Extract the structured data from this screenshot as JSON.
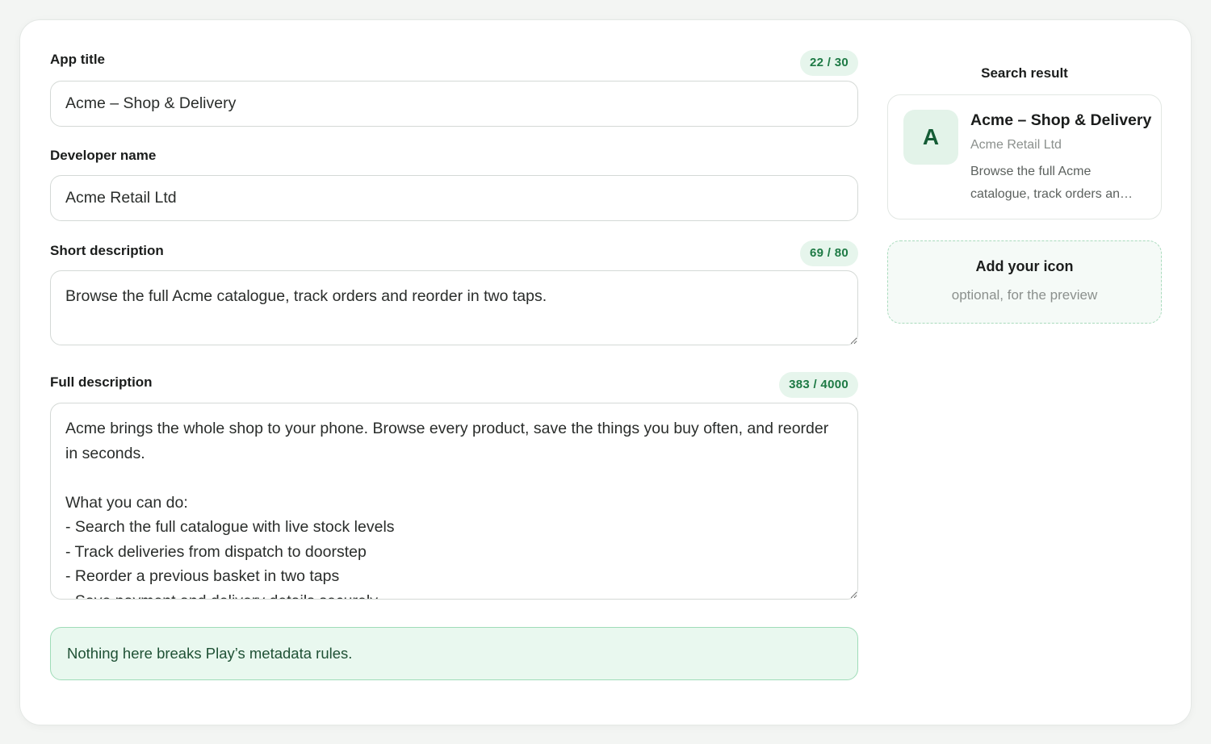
{
  "form": {
    "app_title": {
      "label": "App title",
      "counter": "22 / 30",
      "value": "Acme – Shop & Delivery"
    },
    "developer_name": {
      "label": "Developer name",
      "value": "Acme Retail Ltd"
    },
    "short_description": {
      "label": "Short description",
      "counter": "69 / 80",
      "value": "Browse the full Acme catalogue, track orders and reorder in two taps."
    },
    "full_description": {
      "label": "Full description",
      "counter": "383 / 4000",
      "value": "Acme brings the whole shop to your phone. Browse every product, save the things you buy often, and reorder in seconds.\n\nWhat you can do:\n- Search the full catalogue with live stock levels\n- Track deliveries from dispatch to doorstep\n- Reorder a previous basket in two taps\n- Save payment and delivery details securely"
    },
    "status_message": "Nothing here breaks Play’s metadata rules."
  },
  "preview": {
    "heading": "Search result",
    "icon_letter": "A",
    "title": "Acme – Shop & Delivery",
    "developer": "Acme Retail Ltd",
    "desc_line1": "Browse the full Acme",
    "desc_line2": "catalogue, track orders an…",
    "add_icon_title": "Add your icon",
    "add_icon_subtitle": "optional, for the preview"
  },
  "colors": {
    "accent": "#1e7a45",
    "counter_bg": "#e6f5ec",
    "success_bg": "#e9f8ef",
    "success_border": "#9fdcb8"
  }
}
